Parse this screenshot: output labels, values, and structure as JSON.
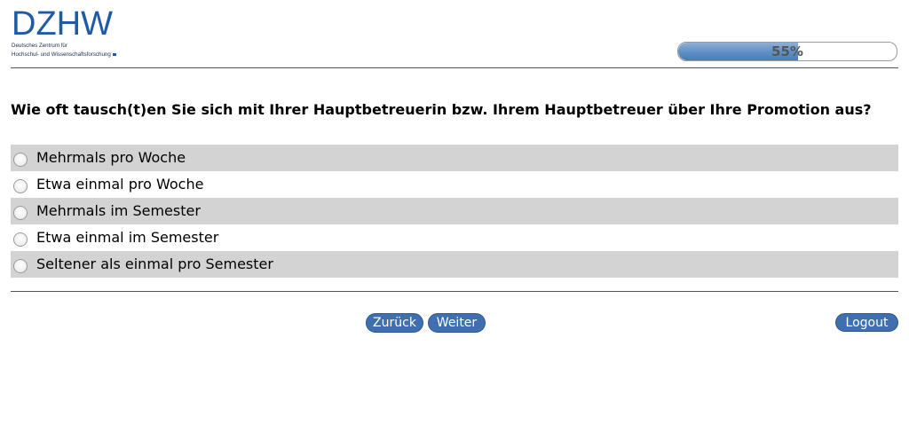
{
  "header": {
    "logo_text": "DZHW",
    "logo_sub_line1": "Deutsches Zentrum für",
    "logo_sub_line2": "Hochschul- und Wissenschaftsforschung"
  },
  "progress": {
    "value": 0.55,
    "label": "55%"
  },
  "question": {
    "text": "Wie oft tausch(t)en Sie sich mit Ihrer Hauptbetreuerin bzw. Ihrem Hauptbetreuer über Ihre Promotion aus?",
    "options": [
      {
        "label": "Mehrmals pro Woche"
      },
      {
        "label": "Etwa einmal pro Woche"
      },
      {
        "label": "Mehrmals im Semester"
      },
      {
        "label": "Etwa einmal im Semester"
      },
      {
        "label": "Seltener als einmal pro Semester"
      }
    ]
  },
  "nav": {
    "back_label": "Zurück",
    "next_label": "Weiter",
    "logout_label": "Logout"
  },
  "colors": {
    "brand": "#1f5aa6",
    "button": "#3f6fae",
    "option_shade": "#d3d3d3"
  }
}
